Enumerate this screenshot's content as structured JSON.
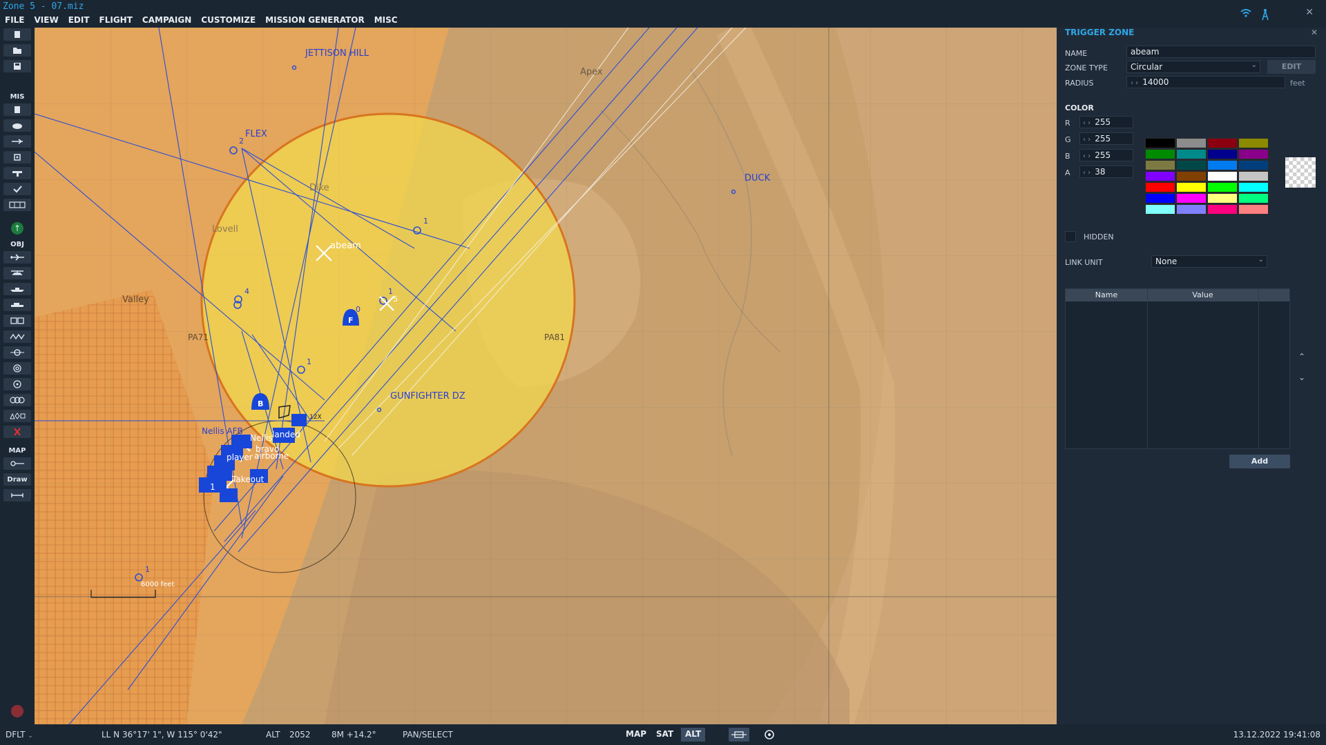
{
  "window": {
    "title": "Zone 5 - 07.miz"
  },
  "menu": [
    "FILE",
    "VIEW",
    "EDIT",
    "FLIGHT",
    "CAMPAIGN",
    "CUSTOMIZE",
    "MISSION GENERATOR",
    "MISC"
  ],
  "toolbar": {
    "mis_label": "MIS",
    "obj_label": "OBJ",
    "map_label": "MAP",
    "draw_label": "Draw"
  },
  "map": {
    "labels": {
      "jettison_hill": "JETTISON HILL",
      "apex": "Apex",
      "flex": "FLEX",
      "dike": "Dike",
      "lovell": "Lovell",
      "abeam": "abeam",
      "valley": "Valley",
      "pa71": "PA71",
      "pa81": "PA81",
      "duck": "DUCK",
      "gunfighter_dz": "GUNFIGHTER DZ",
      "nellis_afb": "Nellis AFB",
      "nellis": "Nellis",
      "bravo": "bravo",
      "player": "player",
      "airborne": "airborne",
      "landed": "landed",
      "takeout": "Takeout",
      "scale": "6000 feet",
      "wp1": "1",
      "wp2": "2",
      "wp4": "4",
      "wp5": "5",
      "wp0": "0",
      "f_marker": "F",
      "b_marker": "B",
      "count12x": "12X"
    }
  },
  "panel": {
    "title": "TRIGGER ZONE",
    "name_label": "NAME",
    "name_value": "abeam",
    "zone_type_label": "ZONE TYPE",
    "zone_type_value": "Circular",
    "edit_button": "EDIT",
    "radius_label": "RADIUS",
    "radius_value": "14000",
    "radius_unit": "feet",
    "color_label": "COLOR",
    "r_label": "R",
    "r_value": "255",
    "g_label": "G",
    "g_value": "255",
    "b_label": "B",
    "b_value": "255",
    "a_label": "A",
    "a_value": "38",
    "palette": [
      "#000000",
      "#8c8c8c",
      "#8b0010",
      "#8c8a00",
      "#008a00",
      "#008a8a",
      "#00008c",
      "#8a008a",
      "#7c7a42",
      "#004848",
      "#007cf0",
      "#003f7c",
      "#8000ff",
      "#804000",
      "#ffffff",
      "#c4c4c4",
      "#ff0000",
      "#ffff00",
      "#00ff00",
      "#00ffff",
      "#0000ff",
      "#ff00ff",
      "#ffff80",
      "#00ff80",
      "#80ffff",
      "#8080ff",
      "#ff0080",
      "#ff8080"
    ],
    "hidden_label": "HIDDEN",
    "link_unit_label": "LINK UNIT",
    "link_unit_value": "None",
    "table_headers": [
      "Name",
      "Value"
    ],
    "add_button": "Add"
  },
  "status": {
    "profile": "DFLT",
    "coords": "LL  N 36°17' 1\", W 115° 0'42\"",
    "alt_label": "ALT",
    "alt_value": "2052",
    "bearing": "8M  +14.2°",
    "mode": "PAN/SELECT",
    "map_btn": "MAP",
    "sat_btn": "SAT",
    "alt_btn": "ALT",
    "datetime": "13.12.2022 19:41:08"
  }
}
